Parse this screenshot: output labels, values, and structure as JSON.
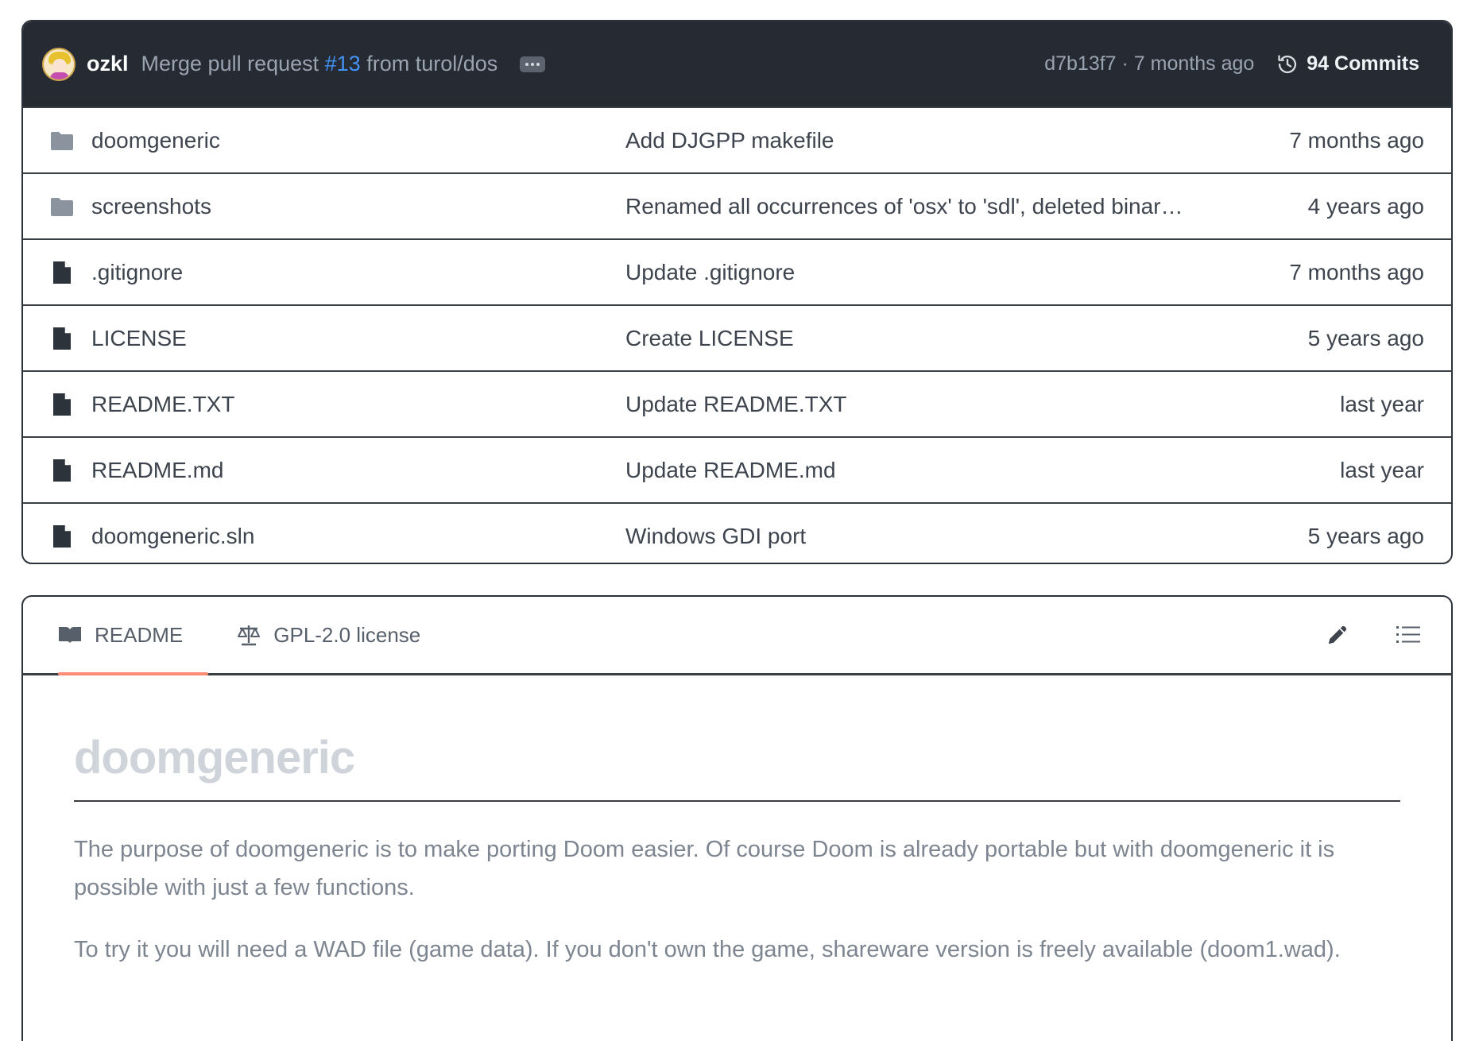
{
  "commit_bar": {
    "author": "ozkl",
    "message_prefix": "Merge pull request ",
    "pr_link": "#13",
    "message_suffix": " from turol/dos",
    "hash_time": "d7b13f7 · 7 months ago",
    "commits_label": "94 Commits"
  },
  "files": [
    {
      "type": "folder",
      "icon": "folder-icon",
      "name": "doomgeneric",
      "message": "Add DJGPP makefile",
      "when": "7 months ago"
    },
    {
      "type": "folder",
      "icon": "folder-icon",
      "name": "screenshots",
      "message": "Renamed all occurrences of 'osx' to 'sdl', deleted binary f....",
      "when": "4 years ago"
    },
    {
      "type": "file",
      "icon": "file-icon",
      "name": ".gitignore",
      "message": "Update .gitignore",
      "when": "7 months ago"
    },
    {
      "type": "file",
      "icon": "file-icon",
      "name": "LICENSE",
      "message": "Create LICENSE",
      "when": "5 years ago"
    },
    {
      "type": "file",
      "icon": "file-icon",
      "name": "README.TXT",
      "message": "Update README.TXT",
      "when": "last year"
    },
    {
      "type": "file",
      "icon": "file-icon",
      "name": "README.md",
      "message": "Update README.md",
      "when": "last year"
    },
    {
      "type": "file",
      "icon": "file-icon",
      "name": "doomgeneric.sln",
      "message": "Windows GDI port",
      "when": "5 years ago"
    }
  ],
  "readme": {
    "tabs": [
      {
        "label": "README",
        "icon": "book-icon",
        "active": true
      },
      {
        "label": "GPL-2.0 license",
        "icon": "scale-icon",
        "active": false
      }
    ],
    "actions": [
      "pencil-icon",
      "list-icon"
    ],
    "title": "doomgeneric",
    "paragraphs": [
      "The purpose of doomgeneric is to make porting Doom easier. Of course Doom is already portable but with doomgeneric it is possible with just a few functions.",
      "To try it you will need a WAD file (game data). If you don't own the game, shareware version is freely available (doom1.wad)."
    ]
  },
  "colors": {
    "header_bg": "#252a33",
    "link": "#4493f8",
    "active_tab_underline": "#fd8c73"
  }
}
